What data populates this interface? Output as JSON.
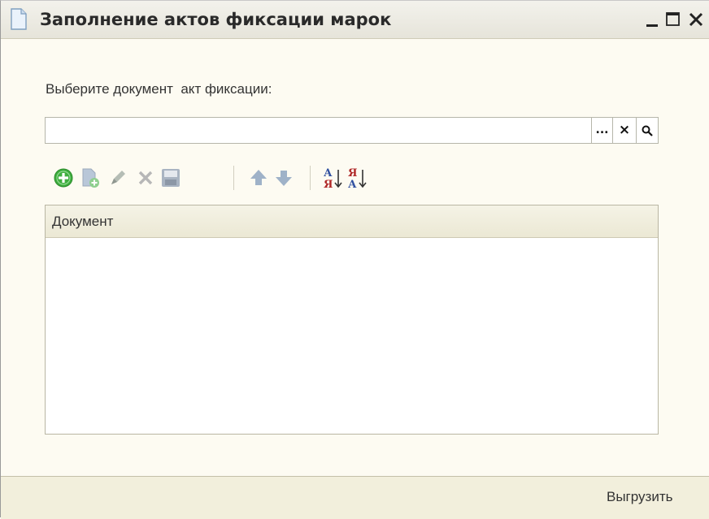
{
  "window": {
    "title": "Заполнение актов фиксации марок",
    "icon": "document-icon",
    "controls": [
      "minimize",
      "maximize",
      "close"
    ]
  },
  "form": {
    "prompt_label": "Выберите документ  акт фиксации:",
    "document_field": {
      "value": "",
      "buttons": {
        "choose_label": "...",
        "clear_label": "×",
        "search_icon": "search-icon"
      }
    }
  },
  "toolbar": {
    "items": [
      "add-icon",
      "copy-icon",
      "edit-icon",
      "delete-icon",
      "save-icon",
      "move-up-icon",
      "move-down-icon",
      "sort-ascending-icon",
      "sort-descending-icon"
    ],
    "sort_asc_top": "А",
    "sort_asc_bottom": "Я",
    "sort_desc_top": "Я",
    "sort_desc_bottom": "А"
  },
  "table": {
    "columns": [
      "Документ"
    ],
    "rows": []
  },
  "footer": {
    "export_label": "Выгрузить"
  },
  "colors": {
    "window_bg": "#fdfbf2",
    "footer_bg": "#f2efdc",
    "add_green": "#3fae3f",
    "sort_blue": "#3050a0",
    "sort_red": "#b02828"
  }
}
